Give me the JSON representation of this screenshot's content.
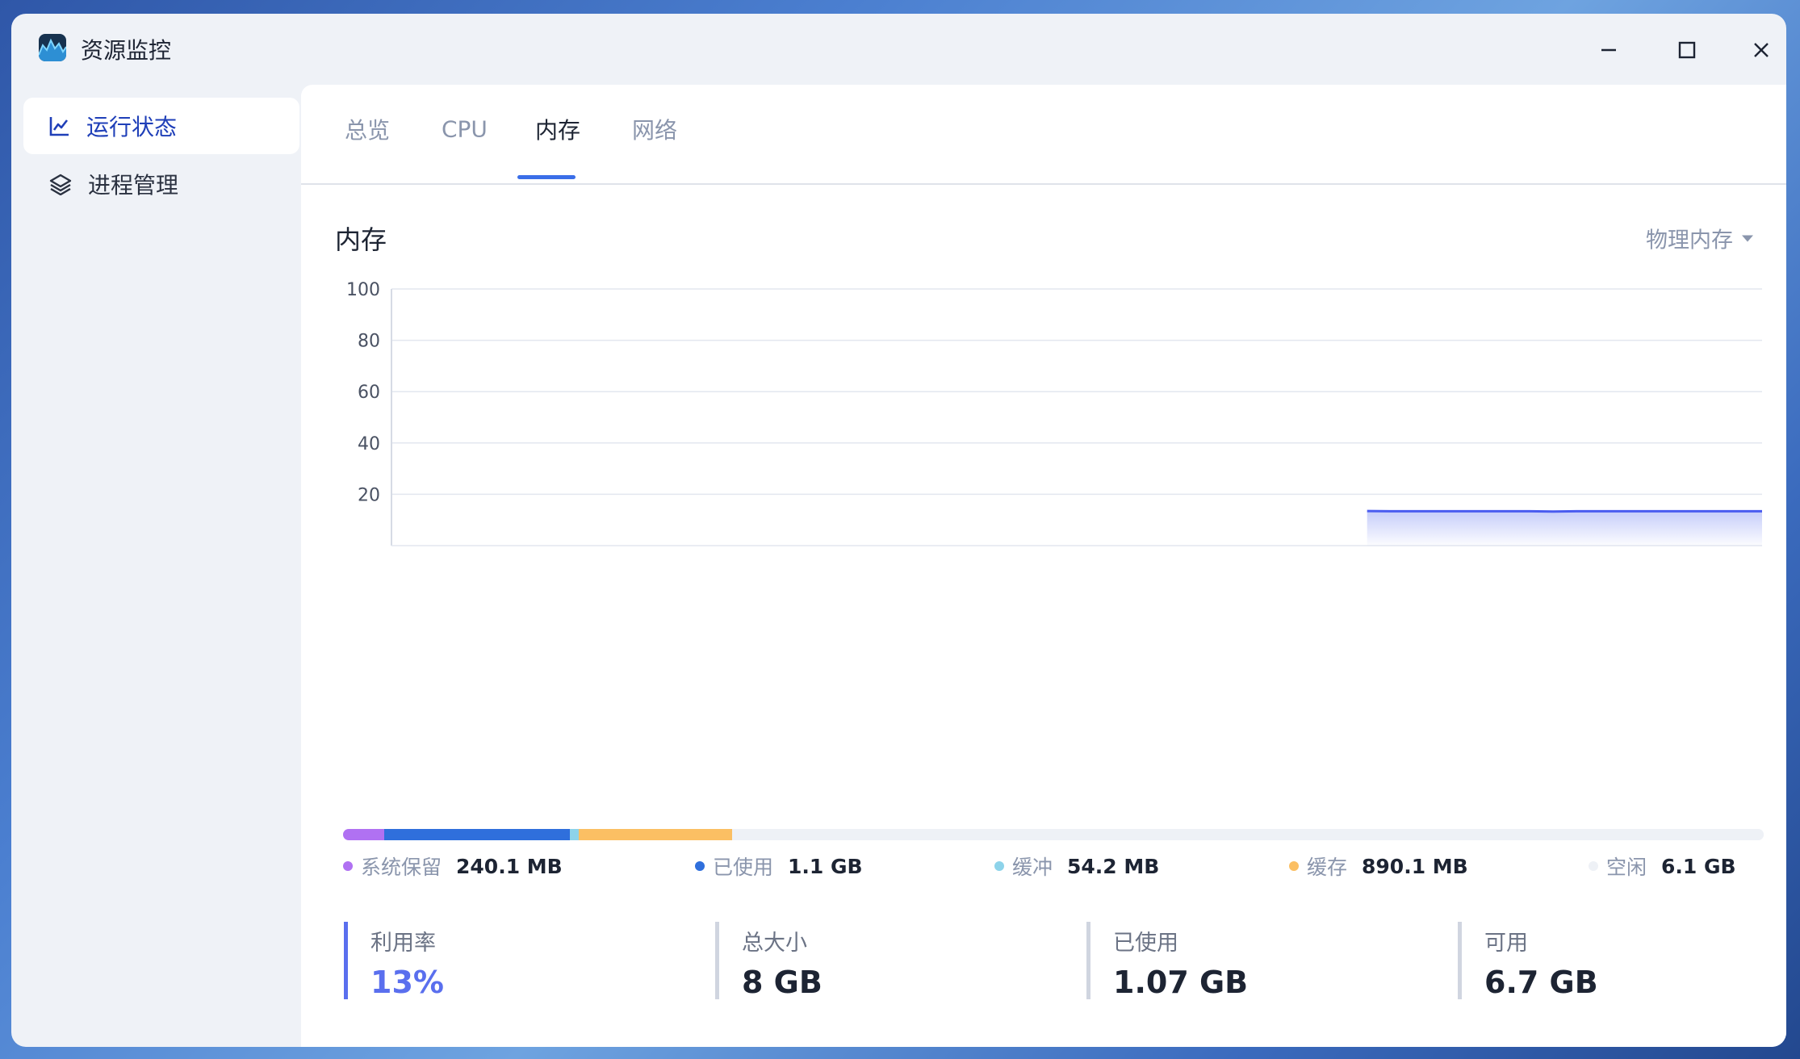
{
  "window": {
    "title": "资源监控",
    "icon": "resource-monitor-app-icon"
  },
  "titlebar_controls": [
    "minimize-icon",
    "maximize-icon",
    "close-icon"
  ],
  "sidebar": {
    "items": [
      {
        "label": "运行状态",
        "icon": "line-chart-icon",
        "active": true
      },
      {
        "label": "进程管理",
        "icon": "layers-icon",
        "active": false
      }
    ]
  },
  "tabs": [
    {
      "label": "总览",
      "active": false
    },
    {
      "label": "CPU",
      "active": false
    },
    {
      "label": "内存",
      "active": true
    },
    {
      "label": "网络",
      "active": false
    }
  ],
  "section": {
    "title": "内存",
    "dropdown_value": "物理内存"
  },
  "chart_data": {
    "type": "area",
    "title": "",
    "xlabel": "",
    "ylabel": "",
    "ylim": [
      0,
      100
    ],
    "yticks": [
      20,
      40,
      60,
      80,
      100
    ],
    "grid": true,
    "x_window_points": 60,
    "series": [
      {
        "color": "#4a5cf0",
        "start_index": 42,
        "values": [
          13.5,
          13.4,
          13.4,
          13.4,
          13.4,
          13.4,
          13.4,
          13.4,
          13.3,
          13.4,
          13.4,
          13.4,
          13.4,
          13.4,
          13.4,
          13.4,
          13.4,
          13.4
        ]
      }
    ]
  },
  "memory_breakdown": [
    {
      "name": "系统保留",
      "value": "240.1 MB",
      "color": "#b071f2",
      "fraction": 0.029
    },
    {
      "name": "已使用",
      "value": "1.1 GB",
      "color": "#2f6fdc",
      "fraction": 0.1306
    },
    {
      "name": "缓冲",
      "value": "54.2 MB",
      "color": "#8dd3ea",
      "fraction": 0.0066
    },
    {
      "name": "缓存",
      "value": "890.1 MB",
      "color": "#fbbf63",
      "fraction": 0.1077
    },
    {
      "name": "空闲",
      "value": "6.1 GB",
      "color": "#eef1f6",
      "fraction": 0.7261
    }
  ],
  "stats": [
    {
      "label": "利用率",
      "value": "13%"
    },
    {
      "label": "总大小",
      "value": "8 GB"
    },
    {
      "label": "已使用",
      "value": "1.07 GB"
    },
    {
      "label": "可用",
      "value": "6.7 GB"
    }
  ]
}
